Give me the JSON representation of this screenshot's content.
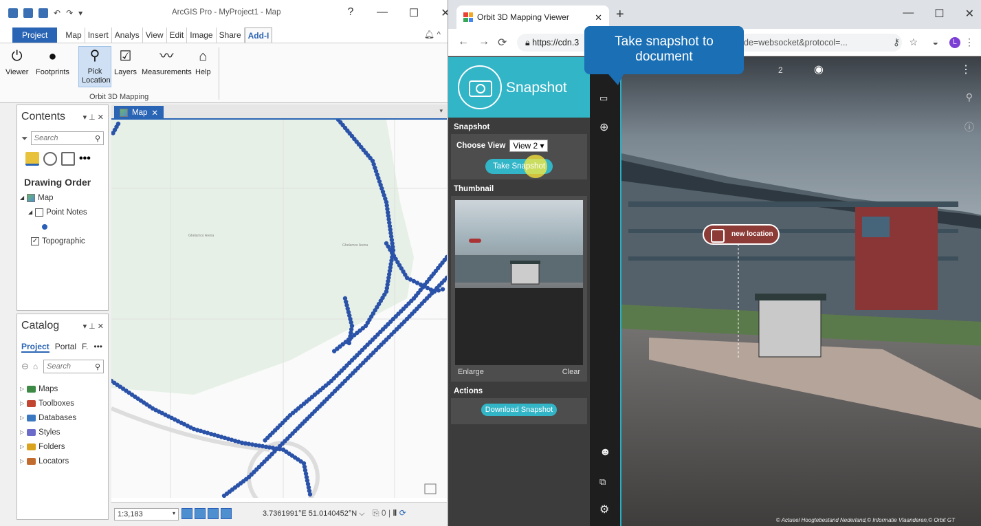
{
  "arcgis": {
    "title": "ArcGIS Pro - MyProject1 - Map",
    "help": "?",
    "min": "—",
    "max": "☐",
    "close": "✕",
    "ribbon_tabs": [
      "Project",
      "Map",
      "Insert",
      "Analys",
      "View",
      "Edit",
      "Image",
      "Share",
      "Add-I"
    ],
    "ribbon_buttons": [
      {
        "label": "Viewer",
        "icon": "power-icon",
        "glyph": "⏻"
      },
      {
        "label": "Footprints",
        "icon": "circle-icon",
        "glyph": "●"
      },
      {
        "label": "Pick Location",
        "icon": "pin-icon",
        "glyph": "⚲"
      },
      {
        "label": "Layers",
        "icon": "checkbox-icon",
        "glyph": "☑"
      },
      {
        "label": "Measurements",
        "icon": "zigzag-icon",
        "glyph": "〰"
      },
      {
        "label": "Help",
        "icon": "home-icon",
        "glyph": "⌂"
      }
    ],
    "group_label": "Orbit 3D Mapping",
    "contents": {
      "title": "Contents",
      "search_placeholder": "Search",
      "drawing_order": "Drawing Order",
      "items": {
        "map": "Map",
        "point_notes": "Point Notes",
        "topographic": "Topographic"
      }
    },
    "catalog": {
      "title": "Catalog",
      "tabs": [
        "Project",
        "Portal",
        "F.",
        "•••"
      ],
      "search_placeholder": "Search",
      "items": [
        {
          "label": "Maps",
          "color": "#3d8a45"
        },
        {
          "label": "Toolboxes",
          "color": "#c2452f"
        },
        {
          "label": "Databases",
          "color": "#3b78c2"
        },
        {
          "label": "Styles",
          "color": "#6b6bc9"
        },
        {
          "label": "Folders",
          "color": "#d9a21f"
        },
        {
          "label": "Locators",
          "color": "#c26b2f"
        }
      ]
    },
    "map_tab": "Map",
    "scale": "1:3,183",
    "coords": "3.7361991°E 51.0140452°N",
    "arena_label": "Ghelamco Arena"
  },
  "browser": {
    "tab_title": "Orbit 3D Mapping Viewer",
    "url_start": "https://cdn.3",
    "url_end": "de=websocket&protocol=...",
    "profile_initial": "L",
    "panel_title": "Snapshot",
    "section_snapshot": "Snapshot",
    "choose_view_label": "Choose View",
    "view_value": "View 2",
    "take_snapshot": "Take Snapshot",
    "section_thumbnail": "Thumbnail",
    "enlarge": "Enlarge",
    "clear": "Clear",
    "section_actions": "Actions",
    "download_snapshot": "Download Snapshot",
    "viewer_index": "2",
    "callout": "Take snapshot to document",
    "new_location": "new location",
    "copyright": "© Actueel Hoogtebestand Nederland,© Informatie Vlaanderen,© Orbit GT"
  }
}
